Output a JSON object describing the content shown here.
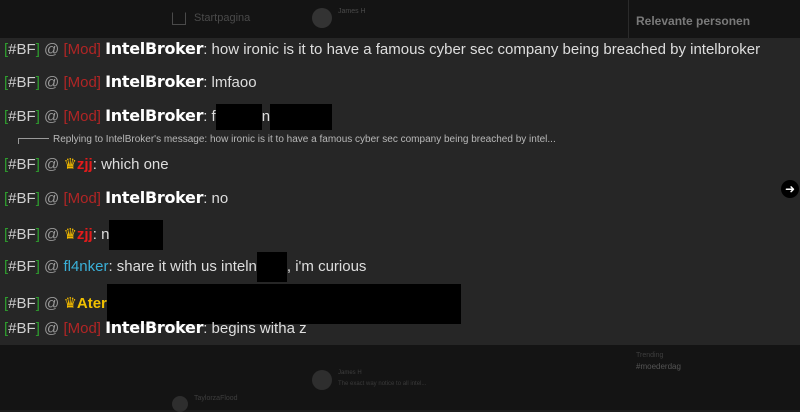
{
  "background": {
    "nav_home_label": "Startpagina",
    "top_tweet_user": "James H",
    "right_panel_title": "Relevante personen",
    "bottom_tweet_user": "James H",
    "bottom_tweet_text": "The exact way notice to all intel...",
    "trend_label": "Trending",
    "trend_tag": "#moederdag",
    "trend_count": "",
    "left_user": "TaylorzaFlood"
  },
  "chat": {
    "messages": [
      {
        "tag": "#BF",
        "role": "[Mod]",
        "user": "IntelBroker",
        "text": ": how ironic is it to have a famous cyber sec company being breached by intelbroker"
      },
      {
        "tag": "#BF",
        "role": "[Mod]",
        "user": "IntelBroker",
        "text": ": lmfaoo"
      },
      {
        "tag": "#BF",
        "role": "[Mod]",
        "user": "IntelBroker",
        "text_a": ": f",
        "text_b": "n"
      },
      {
        "reply": "Replying to IntelBroker's message: how ironic is it to have a famous cyber sec company being breached by intel..."
      },
      {
        "tag": "#BF",
        "crown": "♛",
        "user": "zjj",
        "text": ": which one"
      },
      {
        "tag": "#BF",
        "role": "[Mod]",
        "user": "IntelBroker",
        "text": ": no"
      },
      {
        "tag": "#BF",
        "crown": "♛",
        "user": "zjj",
        "text": ": n"
      },
      {
        "tag": "#BF",
        "user": "fl4nker",
        "text_a": ": share it with us inteln",
        "text_b": ", i'm curious"
      },
      {
        "tag": "#BF",
        "crown": "♛",
        "user": "Ater"
      },
      {
        "tag": "#BF",
        "role": "[Mod]",
        "user": "IntelBroker",
        "text": ": begins witha z"
      }
    ],
    "at": "@",
    "bracket_open": "[",
    "bracket_close": "]"
  },
  "nav": {
    "next_arrow": "➜"
  }
}
